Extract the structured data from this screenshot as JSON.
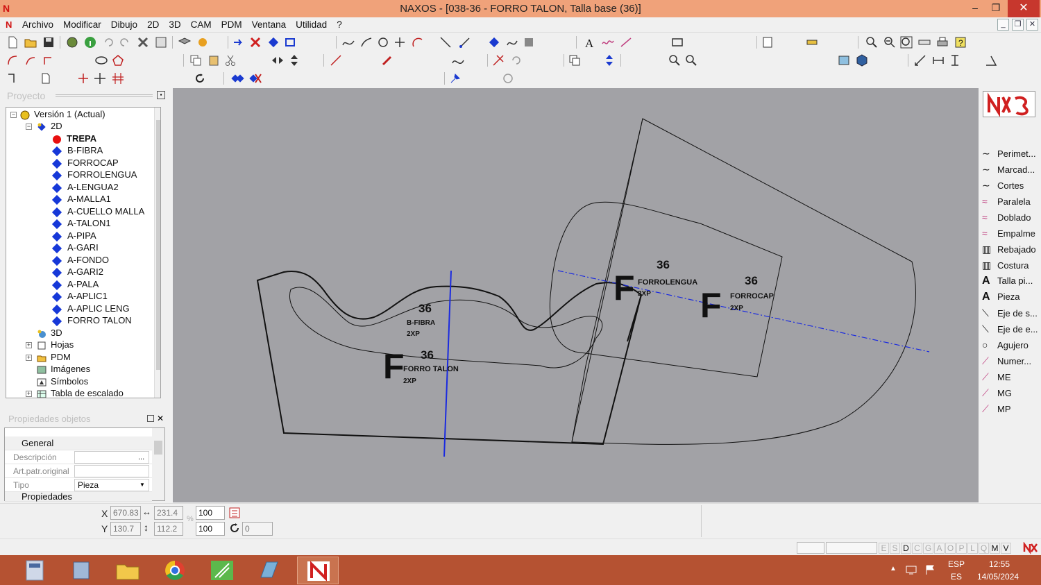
{
  "window": {
    "title": "NAXOS - [038-36 - FORRO TALON, Talla base (36)]",
    "app_logo": "N",
    "minimize": "‒",
    "maximize": "❐",
    "close": "✕"
  },
  "menu": {
    "items": [
      "Archivo",
      "Modificar",
      "Dibujo",
      "2D",
      "3D",
      "CAM",
      "PDM",
      "Ventana",
      "Utilidad",
      "?"
    ]
  },
  "mdi_controls": [
    "_",
    "❐",
    "✕"
  ],
  "project_panel": {
    "header": "Proyecto",
    "tree": [
      {
        "label": "Versión 1 (Actual)",
        "icon": "version-icon"
      },
      {
        "label": "2D",
        "icon": "2d-icon"
      },
      {
        "label": "TREPA",
        "icon": "red-dot-icon",
        "bold": true
      },
      {
        "label": "B-FIBRA",
        "icon": "blue-diamond-icon"
      },
      {
        "label": "FORROCAP",
        "icon": "blue-diamond-icon"
      },
      {
        "label": "FORROLENGUA",
        "icon": "blue-diamond-icon"
      },
      {
        "label": "A-LENGUA2",
        "icon": "blue-diamond-icon"
      },
      {
        "label": "A-MALLA1",
        "icon": "blue-diamond-icon"
      },
      {
        "label": "A-CUELLO MALLA",
        "icon": "blue-diamond-icon"
      },
      {
        "label": "A-TALON1",
        "icon": "blue-diamond-icon"
      },
      {
        "label": "A-PIPA",
        "icon": "blue-diamond-icon"
      },
      {
        "label": "A-GARI",
        "icon": "blue-diamond-icon"
      },
      {
        "label": "A-FONDO",
        "icon": "blue-diamond-icon"
      },
      {
        "label": "A-GARI2",
        "icon": "blue-diamond-icon"
      },
      {
        "label": "A-PALA",
        "icon": "blue-diamond-icon"
      },
      {
        "label": "A-APLIC1",
        "icon": "blue-diamond-icon"
      },
      {
        "label": "A-APLIC LENG",
        "icon": "blue-diamond-icon"
      },
      {
        "label": "FORRO TALON",
        "icon": "blue-diamond-icon"
      },
      {
        "label": "3D",
        "icon": "3d-icon"
      },
      {
        "label": "Hojas",
        "icon": "sheets-icon"
      },
      {
        "label": "PDM",
        "icon": "folder-icon"
      },
      {
        "label": "Imágenes",
        "icon": "images-icon"
      },
      {
        "label": "Símbolos",
        "icon": "symbols-icon"
      },
      {
        "label": "Tabla de escalado",
        "icon": "table-icon"
      }
    ]
  },
  "properties_panel": {
    "header": "Propiedades objetos",
    "sections": {
      "general": "General",
      "properties": "Propiedades"
    },
    "rows": [
      {
        "key": "Descripción",
        "value": ""
      },
      {
        "key": "Art.patr.original",
        "value": ""
      },
      {
        "key": "Tipo",
        "value": "Pieza"
      }
    ],
    "desc_button": "..."
  },
  "canvas": {
    "background": "#a2a2a6",
    "labels": [
      {
        "size": "36",
        "name": "B-FIBRA",
        "qty": "2XP"
      },
      {
        "size": "36",
        "name": "FORRO TALON",
        "qty": "2XP",
        "grain": "F"
      },
      {
        "size": "36",
        "name": "FORROLENGUA",
        "qty": "2XP",
        "grain": "F"
      },
      {
        "size": "36",
        "name": "FORROCAP",
        "qty": "2XP",
        "grain": "F"
      }
    ]
  },
  "right_tools": [
    {
      "label": "Perimet...",
      "icon": "curve-icon"
    },
    {
      "label": "Marcad...",
      "icon": "curve-icon"
    },
    {
      "label": "Cortes",
      "icon": "curve-icon"
    },
    {
      "label": "Paralela",
      "icon": "parallel-curve-icon"
    },
    {
      "label": "Doblado",
      "icon": "parallel-curve-icon"
    },
    {
      "label": "Empalme",
      "icon": "parallel-curve-icon"
    },
    {
      "label": "Rebajado",
      "icon": "skive-icon"
    },
    {
      "label": "Costura",
      "icon": "seam-icon"
    },
    {
      "label": "Talla pi...",
      "icon": "text-a-icon"
    },
    {
      "label": "Pieza",
      "icon": "text-a-icon"
    },
    {
      "label": "Eje de s...",
      "icon": "axis-icon"
    },
    {
      "label": "Eje de e...",
      "icon": "axis-icon"
    },
    {
      "label": "Agujero",
      "icon": "circle-icon"
    },
    {
      "label": "Numer...",
      "icon": "notch-icon"
    },
    {
      "label": "ME",
      "icon": "notch-icon"
    },
    {
      "label": "MG",
      "icon": "notch-icon"
    },
    {
      "label": "MP",
      "icon": "notch-icon"
    }
  ],
  "coords": {
    "x_label": "X",
    "y_label": "Y",
    "x": "670.83",
    "y": "130.7",
    "width": "231.4",
    "height": "112.2",
    "scale_x": "100",
    "scale_y": "100",
    "percent": "%",
    "rotation": "0"
  },
  "status": {
    "letters": [
      "E",
      "S",
      "D",
      "C",
      "G",
      "A",
      "O",
      "P",
      "L",
      "Q",
      "M",
      "V"
    ],
    "active": [
      "D",
      "M",
      "V"
    ]
  },
  "taskbar": {
    "apps": [
      "calculator",
      "explorer-app",
      "file-explorer",
      "chrome",
      "green-app",
      "notepad-app",
      "naxos"
    ],
    "lang": "ESP",
    "region": "ES",
    "time": "12:55",
    "date": "14/05/2024"
  }
}
